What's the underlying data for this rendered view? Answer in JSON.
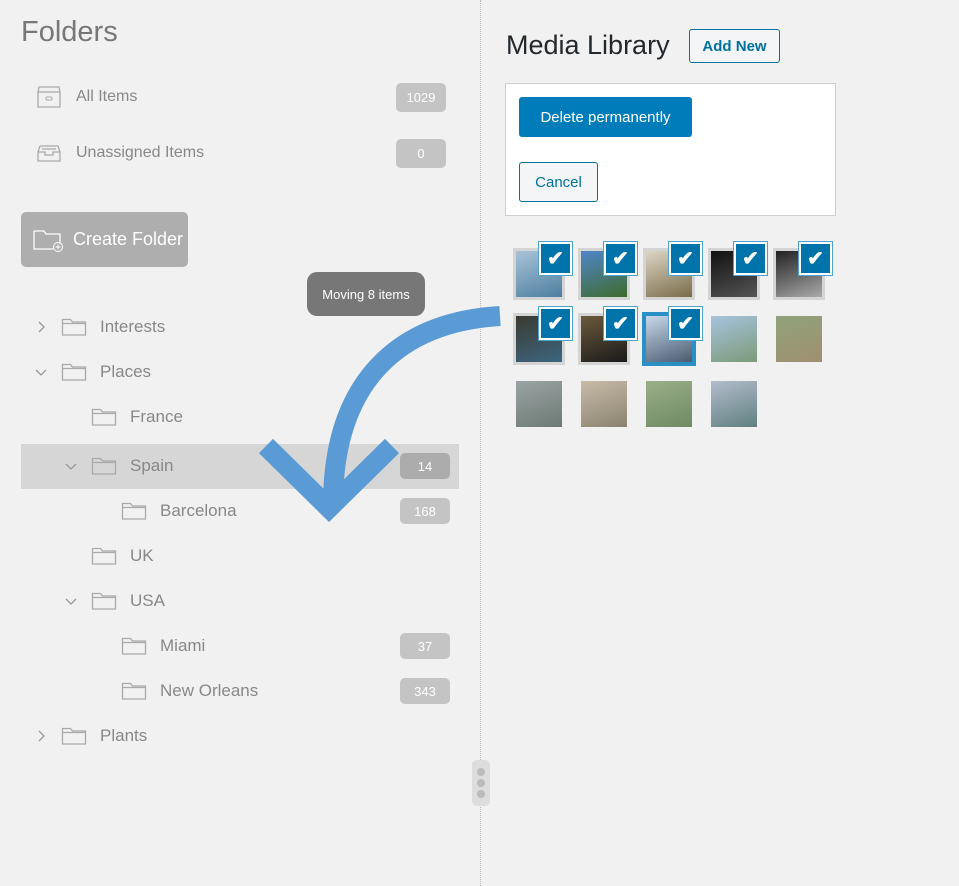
{
  "sidebar": {
    "title": "Folders",
    "all_items": {
      "label": "All Items",
      "count": "1029",
      "icon": "archive-box-icon"
    },
    "unassigned_items": {
      "label": "Unassigned Items",
      "count": "0",
      "icon": "inbox-tray-icon"
    },
    "create_folder": "Create Folder",
    "tree": [
      {
        "name": "Interests",
        "level": 0,
        "expander": "collapsed",
        "count": null
      },
      {
        "name": "Places",
        "level": 0,
        "expander": "expanded",
        "count": null
      },
      {
        "name": "France",
        "level": 1,
        "expander": "none",
        "count": null
      },
      {
        "name": "Spain",
        "level": 1,
        "expander": "expanded",
        "count": "14",
        "highlighted": true
      },
      {
        "name": "Barcelona",
        "level": 2,
        "expander": "none",
        "count": "168"
      },
      {
        "name": "UK",
        "level": 1,
        "expander": "none",
        "count": null
      },
      {
        "name": "USA",
        "level": 1,
        "expander": "expanded",
        "count": null
      },
      {
        "name": "Miami",
        "level": 2,
        "expander": "none",
        "count": "37"
      },
      {
        "name": "New Orleans",
        "level": 2,
        "expander": "none",
        "count": "343"
      },
      {
        "name": "Plants",
        "level": 0,
        "expander": "collapsed",
        "count": null
      }
    ]
  },
  "drag": {
    "tooltip": "Moving 8 items",
    "arrow_color": "#5b9bd5"
  },
  "main": {
    "title": "Media Library",
    "add_new": "Add New",
    "delete_permanently": "Delete permanently",
    "cancel": "Cancel",
    "accent": "#007cba",
    "thumbnails": [
      {
        "checked": true,
        "colors": [
          "#a9c3d8",
          "#4d7fa0"
        ]
      },
      {
        "checked": true,
        "colors": [
          "#4f86c9",
          "#3f6b2c"
        ]
      },
      {
        "checked": true,
        "colors": [
          "#dcd6c4",
          "#7a6b4a"
        ]
      },
      {
        "checked": true,
        "colors": [
          "#111111",
          "#555555"
        ]
      },
      {
        "checked": true,
        "colors": [
          "#222222",
          "#aaaaaa"
        ]
      },
      {
        "checked": true,
        "colors": [
          "#3a3a30",
          "#3d6680"
        ]
      },
      {
        "checked": true,
        "colors": [
          "#6b5a3c",
          "#1a1a1a"
        ]
      },
      {
        "checked": true,
        "focus": true,
        "colors": [
          "#c8d8ea",
          "#4a5a70"
        ]
      },
      {
        "checked": false,
        "colors": [
          "#a6c4de",
          "#7c9a78"
        ]
      },
      {
        "checked": false,
        "colors": [
          "#8fa27a",
          "#a09070"
        ]
      },
      {
        "checked": false,
        "colors": [
          "#9aa4a4",
          "#6d7a74"
        ]
      },
      {
        "checked": false,
        "colors": [
          "#c8bca8",
          "#8a8270"
        ]
      },
      {
        "checked": false,
        "colors": [
          "#9aaf88",
          "#6e8a64"
        ]
      },
      {
        "checked": false,
        "colors": [
          "#b4bccc",
          "#5f8080"
        ]
      }
    ]
  }
}
